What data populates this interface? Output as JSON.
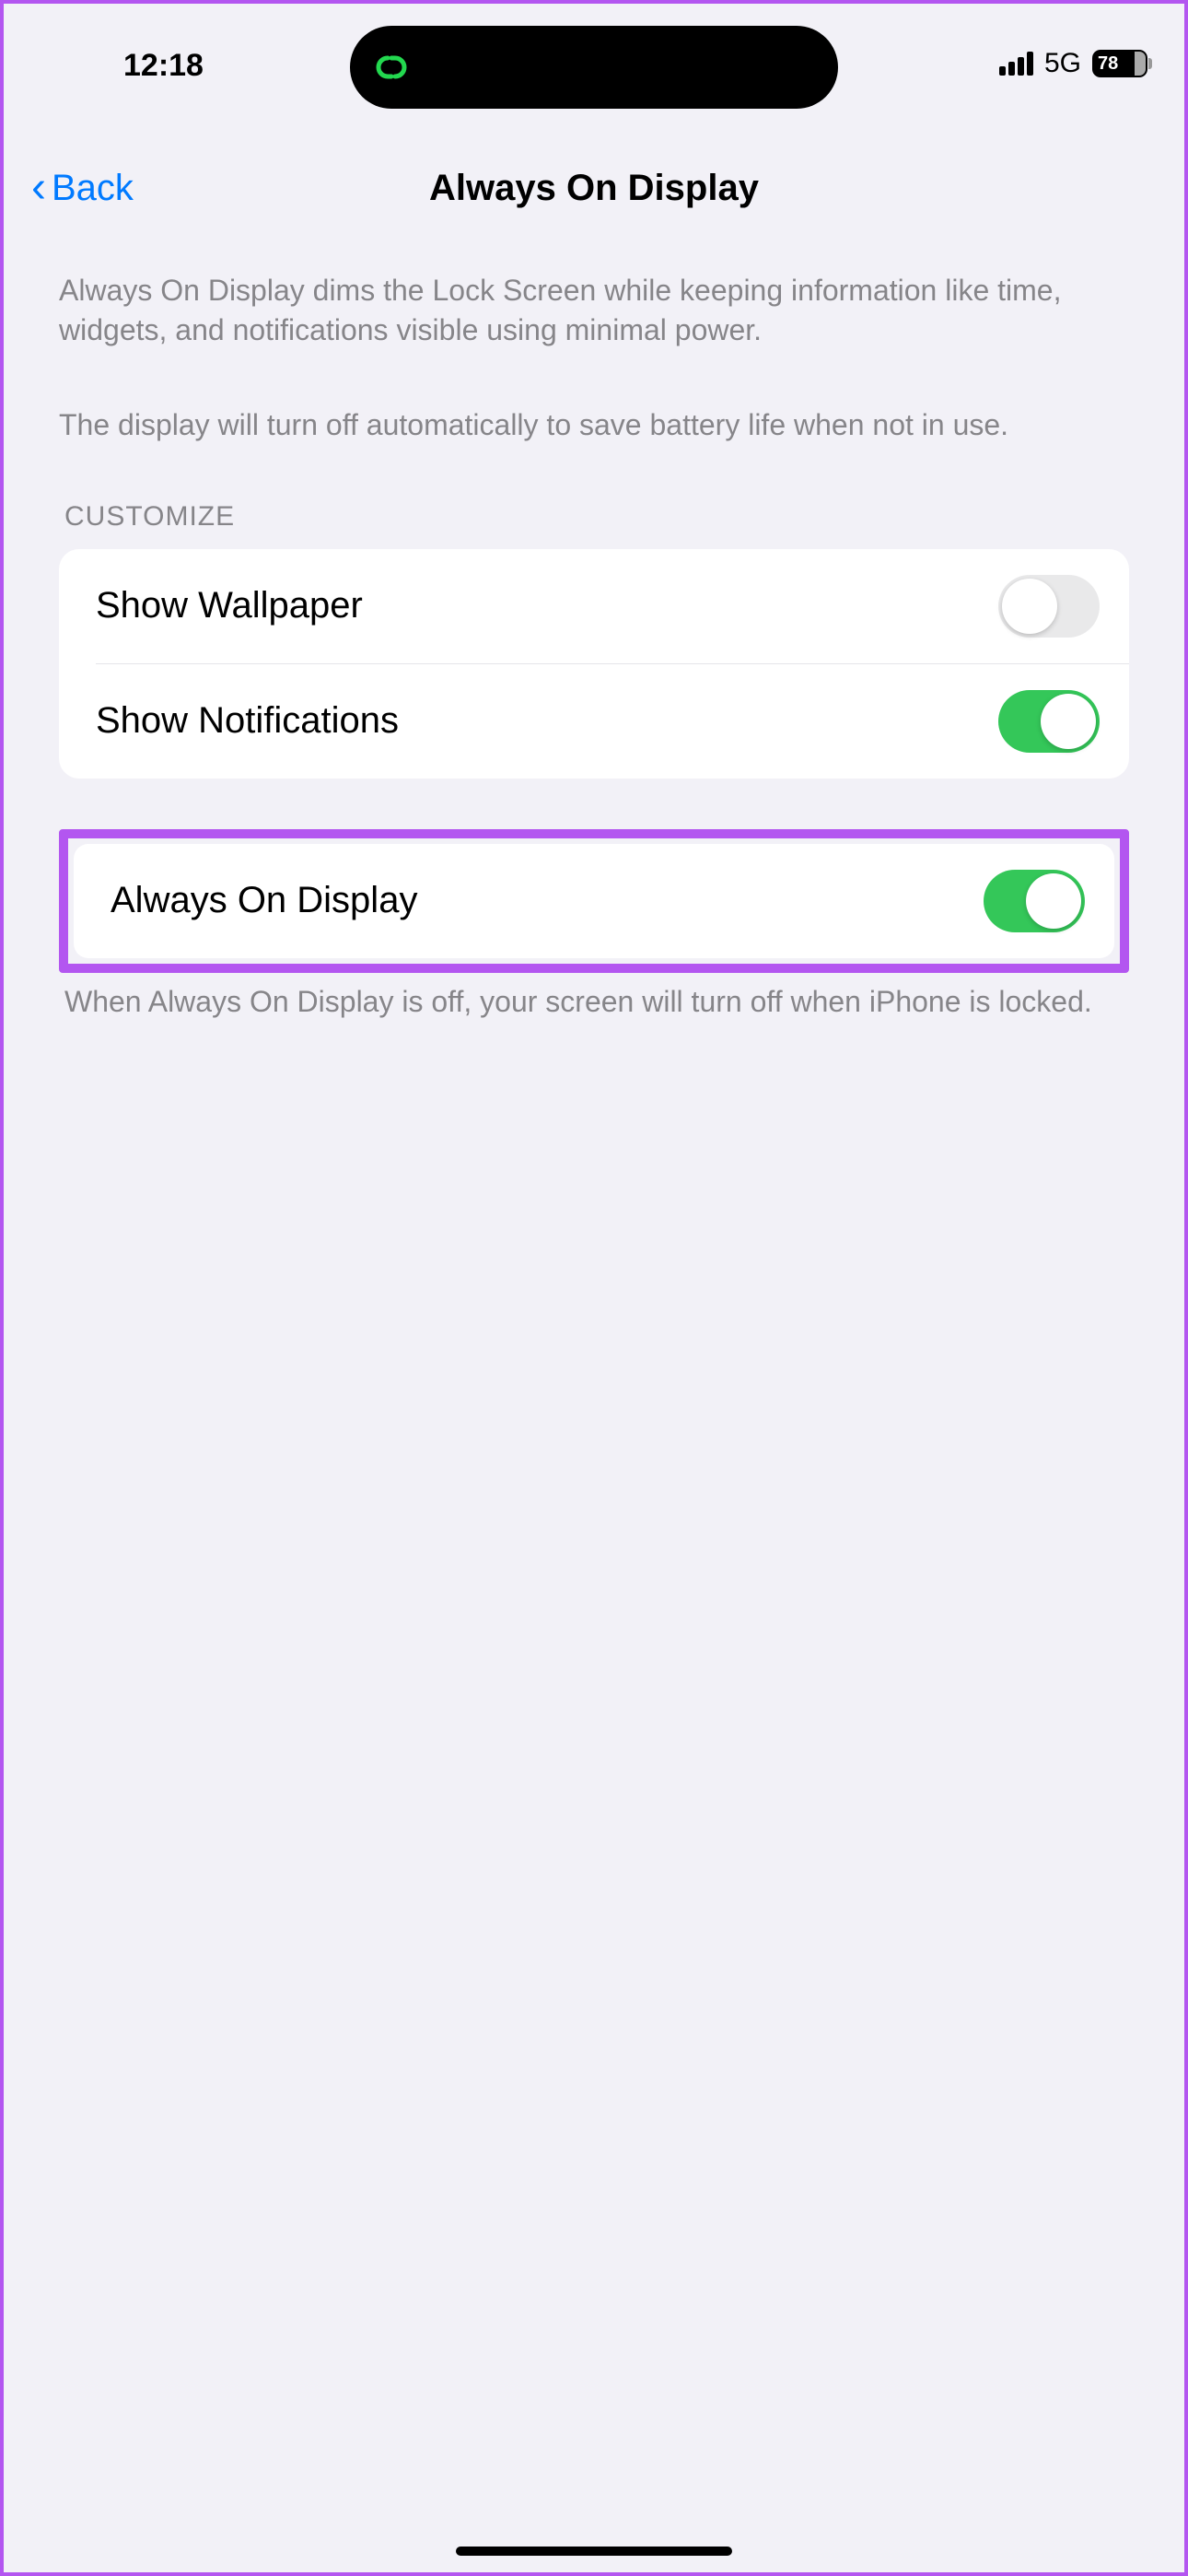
{
  "status_bar": {
    "time": "12:18",
    "network": "5G",
    "battery_percent": "78"
  },
  "nav": {
    "back_label": "Back",
    "title": "Always On Display"
  },
  "description": {
    "paragraph1": "Always On Display dims the Lock Screen while keeping information like time, widgets, and notifications visible using minimal power.",
    "paragraph2": "The display will turn off automatically to save battery life when not in use."
  },
  "sections": {
    "customize": {
      "header": "CUSTOMIZE",
      "rows": [
        {
          "label": "Show Wallpaper",
          "enabled": false
        },
        {
          "label": "Show Notifications",
          "enabled": true
        }
      ]
    },
    "main_toggle": {
      "label": "Always On Display",
      "enabled": true
    },
    "footer": "When Always On Display is off, your screen will turn off when iPhone is locked."
  }
}
